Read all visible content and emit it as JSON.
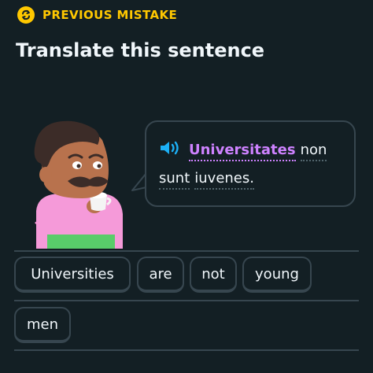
{
  "banner": {
    "icon": "repeat-icon",
    "label": "PREVIOUS MISTAKE",
    "color": "#ffc800"
  },
  "title": "Translate this sentence",
  "prompt": {
    "audio_icon": "speaker-icon",
    "words": [
      "Universitates",
      "non",
      "sunt",
      "iuvenes."
    ],
    "highlighted_word": "Universitates",
    "highlight_color": "#ce82ff"
  },
  "word_bank": [
    "Universities",
    "are",
    "not",
    "young",
    "men"
  ],
  "colors": {
    "background": "#131f24",
    "border": "#37464f",
    "text": "#f1f7fb"
  }
}
